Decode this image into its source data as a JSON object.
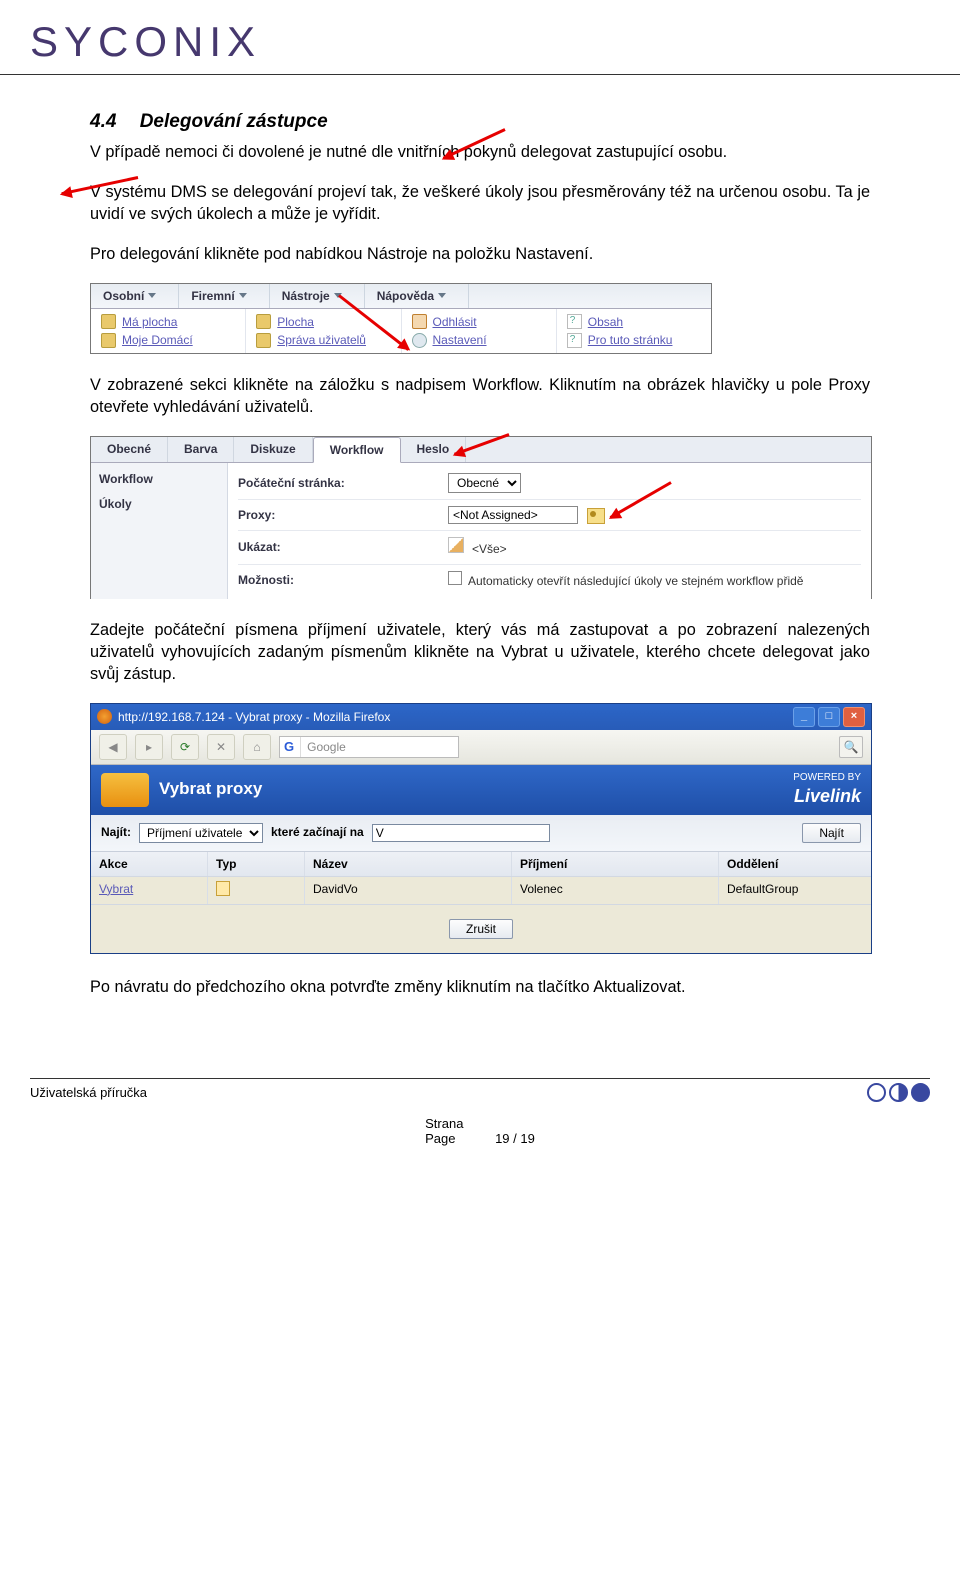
{
  "brand": "SYCONIX",
  "section": {
    "num": "4.4",
    "title": "Delegování zástupce"
  },
  "para1": "V případě nemoci či dovolené je nutné dle vnitřních pokynů delegovat zastupující osobu.",
  "para2": "V systému DMS se delegování projeví tak, že veškeré úkoly jsou přesměrovány též na určenou osobu. Ta je uvidí ve svých úkolech a může je vyřídit.",
  "para3": "Pro delegování klikněte pod nabídkou Nástroje na položku Nastavení.",
  "para4": "V zobrazené sekci klikněte na záložku s nadpisem Workflow. Kliknutím na obrázek hlavičky u pole Proxy otevřete vyhledávání uživatelů.",
  "para5": "Zadejte počáteční písmena příjmení uživatele, který vás má zastupovat a po zobrazení nalezených uživatelů vyhovujících zadaným písmenům klikněte na Vybrat u uživatele, kterého chcete delegovat jako svůj zástup.",
  "para6": "Po návratu do předchozího okna potvrďte změny kliknutím na tlačítko Aktualizovat.",
  "shot1": {
    "menu": [
      "Osobní",
      "Firemní",
      "Nástroje",
      "Nápověda"
    ],
    "col1": [
      "Má plocha",
      "Moje Domácí"
    ],
    "col2": [
      "Plocha",
      "Správa uživatelů"
    ],
    "col3": [
      "Odhlásit",
      "Nastavení"
    ],
    "col4": [
      "Obsah",
      "Pro tuto stránku"
    ]
  },
  "shot2": {
    "tabs": [
      "Obecné",
      "Barva",
      "Diskuze",
      "Workflow",
      "Heslo"
    ],
    "active_tab": 3,
    "left": [
      "Workflow",
      "Úkoly"
    ],
    "rows": {
      "pocatecni_label": "Počáteční stránka:",
      "pocatecni_value": "Obecné",
      "proxy_label": "Proxy:",
      "proxy_value": "<Not Assigned>",
      "ukazat_label": "Ukázat:",
      "ukazat_value": "<Vše>",
      "moznosti_label": "Možnosti:",
      "moznosti_text": "Automaticky otevřít následující úkoly ve stejném workflow přidě"
    }
  },
  "shot3": {
    "title": "http://192.168.7.124 - Vybrat proxy - Mozilla Firefox",
    "search_placeholder": "Google",
    "header": "Vybrat proxy",
    "powered": "POWERED BY",
    "brand": "Livelink",
    "find_label": "Najít:",
    "find_field": "Příjmení uživatele",
    "find_mode": "které začínají na",
    "find_value": "V",
    "find_btn": "Najít",
    "cols": [
      "Akce",
      "Typ",
      "Název",
      "Příjmení",
      "Oddělení"
    ],
    "row": {
      "akce": "Vybrat",
      "nazev": "DavidVo",
      "prijmeni": "Volenec",
      "oddeleni": "DefaultGroup"
    },
    "cancel": "Zrušit"
  },
  "footer": {
    "left": "Uživatelská příručka",
    "strana": "Strana",
    "page": "Page",
    "num": "19 / 19"
  }
}
